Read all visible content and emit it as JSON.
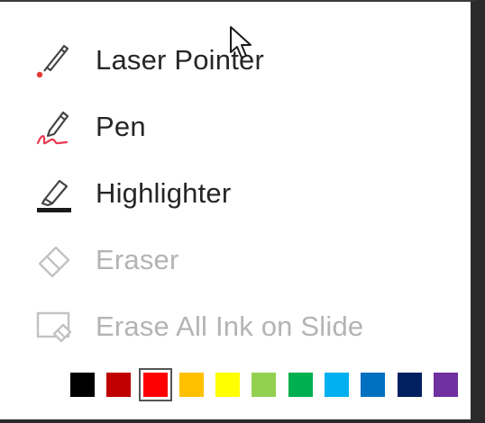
{
  "menu": {
    "items": [
      {
        "label": "Laser Pointer",
        "icon": "laser-pointer-icon",
        "enabled": true
      },
      {
        "label": "Pen",
        "icon": "pen-icon",
        "enabled": true
      },
      {
        "label": "Highlighter",
        "icon": "highlighter-icon",
        "enabled": true
      },
      {
        "label": "Eraser",
        "icon": "eraser-icon",
        "enabled": false
      },
      {
        "label": "Erase All Ink on Slide",
        "icon": "erase-all-icon",
        "enabled": false
      }
    ]
  },
  "colors": {
    "selected_index": 2,
    "swatches": [
      "#000000",
      "#c00000",
      "#ff0000",
      "#ffc000",
      "#ffff00",
      "#92d050",
      "#00b050",
      "#00b0f0",
      "#0070c0",
      "#002060",
      "#7030a0"
    ]
  },
  "theme": {
    "text": "#262626",
    "disabled_text": "#b4b4b4",
    "pen_accent": "#e8384f",
    "laser_dot": "#e53935"
  }
}
